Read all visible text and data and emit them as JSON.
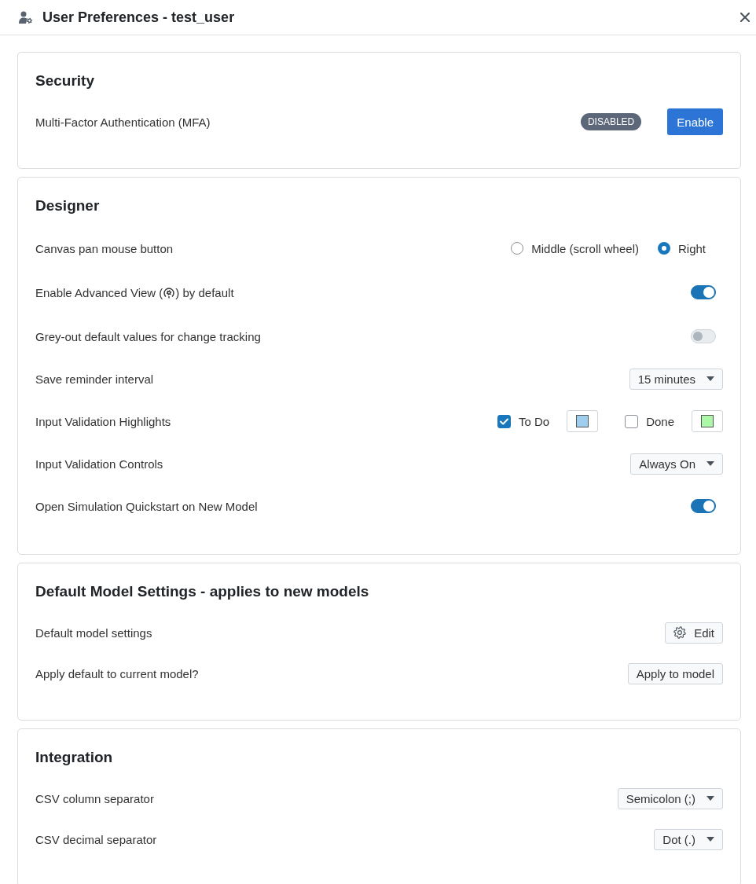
{
  "window": {
    "title": "User Preferences - test_user"
  },
  "sections": [
    {
      "title": "Security",
      "rows": [
        {
          "kind": "status",
          "label": "Multi-Factor Authentication (MFA)",
          "badge": "DISABLED",
          "button": "Enable"
        }
      ]
    },
    {
      "title": "Designer",
      "rows": [
        {
          "kind": "radio",
          "label": "Canvas pan mouse button",
          "options": [
            {
              "label": "Middle (scroll wheel)",
              "selected": false
            },
            {
              "label": "Right",
              "selected": true
            }
          ]
        },
        {
          "kind": "toggle",
          "label": "Enable Advanced View (",
          "label_after": ") by default",
          "on": true
        },
        {
          "kind": "toggle",
          "label": "Grey-out default values for change tracking",
          "on": false
        },
        {
          "kind": "select",
          "label": "Save reminder interval",
          "value": "15 minutes"
        },
        {
          "kind": "checks",
          "label": "Input Validation Highlights",
          "options": [
            {
              "label": "To Do",
              "checked": true,
              "color": "#9fcdee"
            },
            {
              "label": "Done",
              "checked": false,
              "color": "#aaf8a8"
            }
          ]
        },
        {
          "kind": "select",
          "label": "Input Validation Controls",
          "value": "Always On"
        },
        {
          "kind": "toggle",
          "label": "Open Simulation Quickstart on New Model",
          "on": true
        }
      ]
    },
    {
      "title": "Default Model Settings - applies to new models",
      "rows": [
        {
          "kind": "iconbutton",
          "label": "Default model settings",
          "button": "Edit"
        },
        {
          "kind": "button",
          "label": "Apply default to current model?",
          "button": "Apply to model"
        }
      ]
    },
    {
      "title": "Integration",
      "rows": [
        {
          "kind": "select",
          "label": "CSV column separator",
          "value": "Semicolon (;)"
        },
        {
          "kind": "select",
          "label": "CSV decimal separator",
          "value": "Dot (.)"
        }
      ]
    }
  ]
}
